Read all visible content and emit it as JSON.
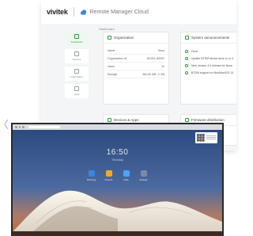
{
  "dashboard": {
    "brand": "vivitek",
    "app_title": "Remote Manager Cloud",
    "breadcrumb": "Dashboard",
    "sidebar": [
      {
        "label": "Dashboard",
        "icon": "grid-icon",
        "active": true
      },
      {
        "label": "Devices",
        "icon": "device-icon",
        "active": false
      },
      {
        "label": "Organization",
        "icon": "organization-icon",
        "active": false
      },
      {
        "label": "Apps",
        "icon": "apps-icon",
        "active": false
      }
    ],
    "cards": {
      "organization": {
        "title": "Organization",
        "rows": [
          {
            "label": "Name",
            "value": "Nova"
          },
          {
            "label": "Organization ID",
            "value": "ND001-N0002"
          },
          {
            "label": "Users",
            "value": "10"
          },
          {
            "label": "Storage",
            "value": "384.60 MB / 2 GB"
          }
        ]
      },
      "announcements": {
        "title": "System announcements",
        "items": [
          "Feed",
          "Update BTDM device drive to v1.4",
          "New version 3.0 release for Nova",
          "BTDM support on MacMac/iOS 14"
        ]
      },
      "devices_apps": {
        "title": "Devices & Apps"
      },
      "firmware": {
        "title": "Firmware distribution"
      }
    }
  },
  "desktop": {
    "clock": "16:50",
    "date": "Thursday",
    "apps": [
      {
        "label": "Mirroring",
        "color": "#3a86d9"
      },
      {
        "label": "Present",
        "color": "#f0a92a"
      },
      {
        "label": "Files",
        "color": "#4aa3ff"
      },
      {
        "label": "Settings",
        "color": "#7a8ba8"
      }
    ]
  },
  "colors": {
    "accent": "#2f9e3c",
    "sky_top": "#2b4a7d",
    "sky_bottom": "#c86a3a",
    "building": "#f3eee6"
  }
}
